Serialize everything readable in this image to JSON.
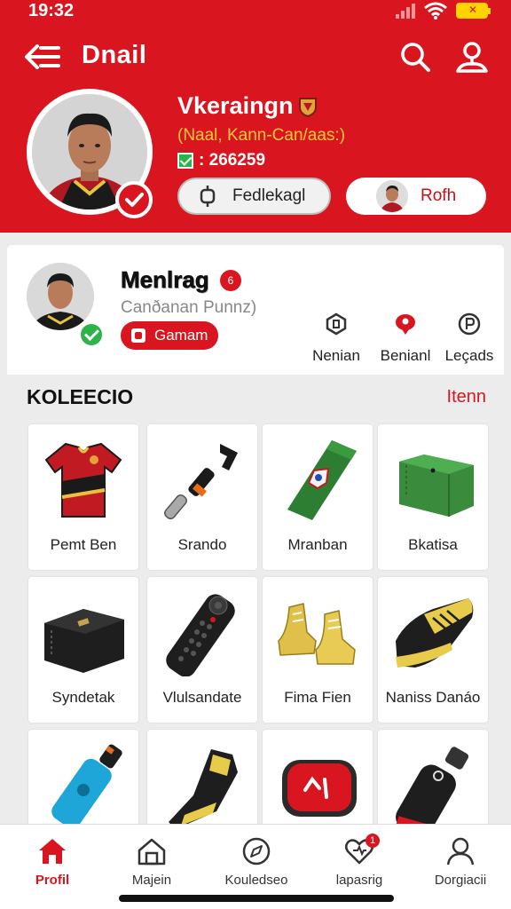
{
  "status": {
    "time": "19:32"
  },
  "header": {
    "title": "Dnail"
  },
  "profile": {
    "name": "Vkeraingn",
    "subtitle": "(Naal, Kann-Can/aas:)",
    "id": ": 266259",
    "follow_label": "Fedlekagl",
    "profile_label": "Rofh"
  },
  "card2": {
    "name": "Menlrag",
    "badge": "6",
    "subtitle": "Canðanan Punnz)",
    "game_label": "Gamam",
    "stats": [
      {
        "label": "Nenian",
        "icon": "hexagon-icon"
      },
      {
        "label": "Benianl",
        "icon": "pin-icon"
      },
      {
        "label": "Leçads",
        "icon": "circle-p-icon"
      }
    ]
  },
  "collection": {
    "title": "KOLEECIO",
    "link": "Itenn",
    "items": [
      {
        "label": "Pemt Ben",
        "icon": "jersey"
      },
      {
        "label": "Srando",
        "icon": "tool-handle"
      },
      {
        "label": "Mranban",
        "icon": "scarf"
      },
      {
        "label": "Bkatisa",
        "icon": "green-bag"
      },
      {
        "label": "Syndetak",
        "icon": "black-bag"
      },
      {
        "label": "Vlulsandate",
        "icon": "remote"
      },
      {
        "label": "Fima Fien",
        "icon": "yellow-shoes"
      },
      {
        "label": "Naniss Danáo",
        "icon": "black-yellow-shoe"
      },
      {
        "label": "",
        "icon": "blue-bottle"
      },
      {
        "label": "",
        "icon": "boot"
      },
      {
        "label": "",
        "icon": "red-case"
      },
      {
        "label": "",
        "icon": "black-bottle"
      }
    ]
  },
  "nav": [
    {
      "label": "Profil",
      "icon": "home-icon"
    },
    {
      "label": "Majein",
      "icon": "house-outline-icon"
    },
    {
      "label": "Kouledseo",
      "icon": "compass-icon"
    },
    {
      "label": "lapasrig",
      "icon": "heart-pin-icon",
      "badge": "1"
    },
    {
      "label": "Dorgiacii",
      "icon": "person-icon"
    }
  ],
  "colors": {
    "brand": "#d9161f",
    "accent": "#ffc83a",
    "success": "#2db34a"
  }
}
